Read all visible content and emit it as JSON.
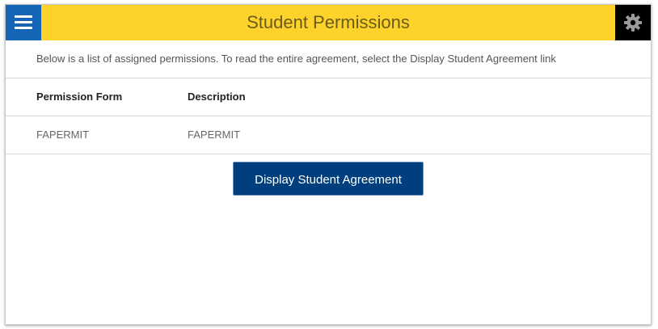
{
  "header": {
    "title": "Student Permissions",
    "menu_icon": "hamburger-menu-icon",
    "settings_icon": "gear-icon"
  },
  "intro": {
    "text": "Below is a list of assigned permissions. To read the entire agreement, select the Display Student Agreement link"
  },
  "table": {
    "columns": [
      "Permission Form",
      "Description"
    ],
    "rows": [
      [
        "FAPERMIT",
        "FAPERMIT"
      ]
    ]
  },
  "actions": {
    "display_agreement_label": "Display Student Agreement"
  },
  "colors": {
    "header_bg": "#fdd32b",
    "menu_bg": "#1566b7",
    "settings_bg": "#000000",
    "button_bg": "#003f7d"
  }
}
